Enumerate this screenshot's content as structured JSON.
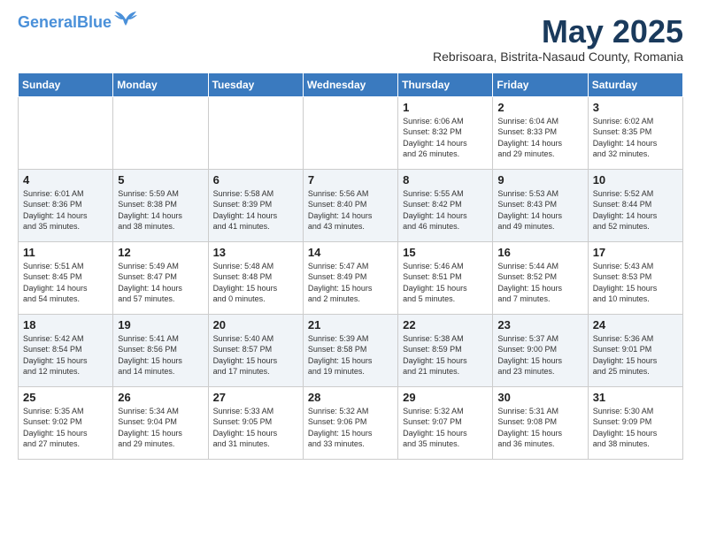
{
  "header": {
    "logo_general": "General",
    "logo_blue": "Blue",
    "month_title": "May 2025",
    "subtitle": "Rebrisoara, Bistrita-Nasaud County, Romania"
  },
  "columns": [
    "Sunday",
    "Monday",
    "Tuesday",
    "Wednesday",
    "Thursday",
    "Friday",
    "Saturday"
  ],
  "weeks": [
    [
      {
        "day": "",
        "text": ""
      },
      {
        "day": "",
        "text": ""
      },
      {
        "day": "",
        "text": ""
      },
      {
        "day": "",
        "text": ""
      },
      {
        "day": "1",
        "text": "Sunrise: 6:06 AM\nSunset: 8:32 PM\nDaylight: 14 hours\nand 26 minutes."
      },
      {
        "day": "2",
        "text": "Sunrise: 6:04 AM\nSunset: 8:33 PM\nDaylight: 14 hours\nand 29 minutes."
      },
      {
        "day": "3",
        "text": "Sunrise: 6:02 AM\nSunset: 8:35 PM\nDaylight: 14 hours\nand 32 minutes."
      }
    ],
    [
      {
        "day": "4",
        "text": "Sunrise: 6:01 AM\nSunset: 8:36 PM\nDaylight: 14 hours\nand 35 minutes."
      },
      {
        "day": "5",
        "text": "Sunrise: 5:59 AM\nSunset: 8:38 PM\nDaylight: 14 hours\nand 38 minutes."
      },
      {
        "day": "6",
        "text": "Sunrise: 5:58 AM\nSunset: 8:39 PM\nDaylight: 14 hours\nand 41 minutes."
      },
      {
        "day": "7",
        "text": "Sunrise: 5:56 AM\nSunset: 8:40 PM\nDaylight: 14 hours\nand 43 minutes."
      },
      {
        "day": "8",
        "text": "Sunrise: 5:55 AM\nSunset: 8:42 PM\nDaylight: 14 hours\nand 46 minutes."
      },
      {
        "day": "9",
        "text": "Sunrise: 5:53 AM\nSunset: 8:43 PM\nDaylight: 14 hours\nand 49 minutes."
      },
      {
        "day": "10",
        "text": "Sunrise: 5:52 AM\nSunset: 8:44 PM\nDaylight: 14 hours\nand 52 minutes."
      }
    ],
    [
      {
        "day": "11",
        "text": "Sunrise: 5:51 AM\nSunset: 8:45 PM\nDaylight: 14 hours\nand 54 minutes."
      },
      {
        "day": "12",
        "text": "Sunrise: 5:49 AM\nSunset: 8:47 PM\nDaylight: 14 hours\nand 57 minutes."
      },
      {
        "day": "13",
        "text": "Sunrise: 5:48 AM\nSunset: 8:48 PM\nDaylight: 15 hours\nand 0 minutes."
      },
      {
        "day": "14",
        "text": "Sunrise: 5:47 AM\nSunset: 8:49 PM\nDaylight: 15 hours\nand 2 minutes."
      },
      {
        "day": "15",
        "text": "Sunrise: 5:46 AM\nSunset: 8:51 PM\nDaylight: 15 hours\nand 5 minutes."
      },
      {
        "day": "16",
        "text": "Sunrise: 5:44 AM\nSunset: 8:52 PM\nDaylight: 15 hours\nand 7 minutes."
      },
      {
        "day": "17",
        "text": "Sunrise: 5:43 AM\nSunset: 8:53 PM\nDaylight: 15 hours\nand 10 minutes."
      }
    ],
    [
      {
        "day": "18",
        "text": "Sunrise: 5:42 AM\nSunset: 8:54 PM\nDaylight: 15 hours\nand 12 minutes."
      },
      {
        "day": "19",
        "text": "Sunrise: 5:41 AM\nSunset: 8:56 PM\nDaylight: 15 hours\nand 14 minutes."
      },
      {
        "day": "20",
        "text": "Sunrise: 5:40 AM\nSunset: 8:57 PM\nDaylight: 15 hours\nand 17 minutes."
      },
      {
        "day": "21",
        "text": "Sunrise: 5:39 AM\nSunset: 8:58 PM\nDaylight: 15 hours\nand 19 minutes."
      },
      {
        "day": "22",
        "text": "Sunrise: 5:38 AM\nSunset: 8:59 PM\nDaylight: 15 hours\nand 21 minutes."
      },
      {
        "day": "23",
        "text": "Sunrise: 5:37 AM\nSunset: 9:00 PM\nDaylight: 15 hours\nand 23 minutes."
      },
      {
        "day": "24",
        "text": "Sunrise: 5:36 AM\nSunset: 9:01 PM\nDaylight: 15 hours\nand 25 minutes."
      }
    ],
    [
      {
        "day": "25",
        "text": "Sunrise: 5:35 AM\nSunset: 9:02 PM\nDaylight: 15 hours\nand 27 minutes."
      },
      {
        "day": "26",
        "text": "Sunrise: 5:34 AM\nSunset: 9:04 PM\nDaylight: 15 hours\nand 29 minutes."
      },
      {
        "day": "27",
        "text": "Sunrise: 5:33 AM\nSunset: 9:05 PM\nDaylight: 15 hours\nand 31 minutes."
      },
      {
        "day": "28",
        "text": "Sunrise: 5:32 AM\nSunset: 9:06 PM\nDaylight: 15 hours\nand 33 minutes."
      },
      {
        "day": "29",
        "text": "Sunrise: 5:32 AM\nSunset: 9:07 PM\nDaylight: 15 hours\nand 35 minutes."
      },
      {
        "day": "30",
        "text": "Sunrise: 5:31 AM\nSunset: 9:08 PM\nDaylight: 15 hours\nand 36 minutes."
      },
      {
        "day": "31",
        "text": "Sunrise: 5:30 AM\nSunset: 9:09 PM\nDaylight: 15 hours\nand 38 minutes."
      }
    ]
  ]
}
